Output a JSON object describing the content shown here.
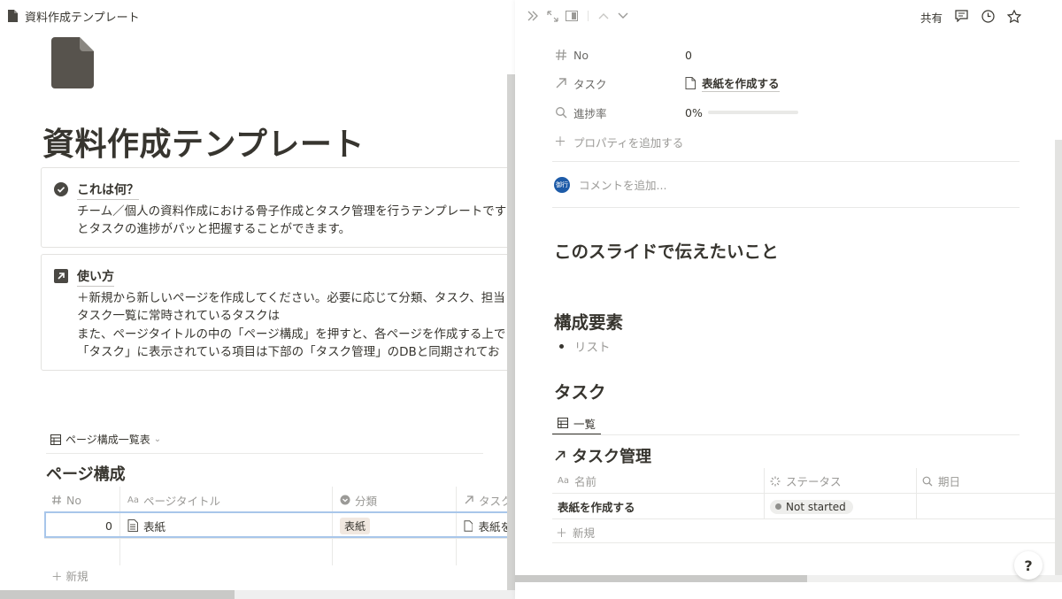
{
  "left": {
    "breadcrumb_title": "資料作成テンプレート",
    "page_title": "資料作成テンプレート",
    "callout1": {
      "title": "これは何？",
      "lines": [
        "チーム／個人の資料作成における骨子作成とタスク管理を行うテンプレートです",
        "とタスクの進捗がパッと把握することができます。"
      ]
    },
    "callout2": {
      "title": "使い方",
      "lines": [
        "＋新規から新しいページを作成してください。必要に応じて分類、タスク、担当",
        "タスク一覧に常時されているタスクは",
        "また、ページタイトルの中の「ページ構成」を押すと、各ページを作成する上で",
        "「タスク」に表示されている項目は下部の「タスク管理」のDBと同期されてお"
      ]
    },
    "db_view_name": "ページ構成一覧表",
    "db_heading": "ページ構成",
    "table": {
      "columns": [
        "No",
        "ページタイトル",
        "分類",
        "タスク"
      ],
      "row": {
        "no": "0",
        "title": "表紙",
        "category": "表紙",
        "task": "表紙を"
      }
    },
    "new_label": "新規"
  },
  "right": {
    "share_label": "共有",
    "props": {
      "no_label": "No",
      "no_value": "0",
      "task_label": "タスク",
      "task_value": "表紙を作成する",
      "progress_label": "進捗率",
      "progress_value": "0%",
      "progress_fraction": 0,
      "add_property": "プロパティを追加する"
    },
    "comment_avatar": "御行",
    "comment_placeholder": "コメントを追加...",
    "heading1": "このスライドで伝えたいこと",
    "heading2": "構成要素",
    "bullet": "リスト",
    "heading3": "タスク",
    "view_tab": "一覧",
    "linked_db_title": "タスク管理",
    "table": {
      "columns": [
        "名前",
        "ステータス",
        "期日"
      ],
      "row": {
        "name": "表紙を作成する",
        "status": "Not started"
      }
    },
    "new_label": "新規",
    "help_label": "?"
  },
  "colors": {
    "text": "#37352f",
    "muted": "#9b9a97",
    "accent": "#2383e2",
    "tag_bg": "#f1e8e0",
    "avatar_bg": "#1d5ba8"
  }
}
